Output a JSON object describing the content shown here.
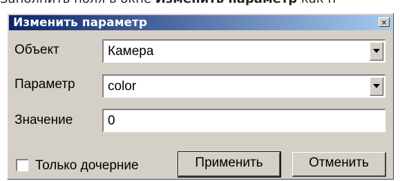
{
  "instruction": {
    "prefix": "Заполнить поля в окне ",
    "bold": "Изменить параметр",
    "suffix": " как п"
  },
  "dialog": {
    "title": "Изменить параметр",
    "close_glyph": "×",
    "object": {
      "label": "Объект",
      "value": "Камера"
    },
    "parameter": {
      "label": "Параметр",
      "value": "color"
    },
    "value": {
      "label": "Значение",
      "value": "0"
    },
    "children_only": {
      "label": "Только дочерние",
      "checked": false
    },
    "apply_label": "Применить",
    "cancel_label": "Отменить"
  }
}
